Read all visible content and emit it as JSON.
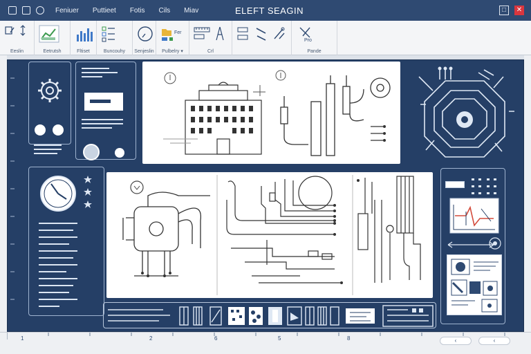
{
  "window": {
    "title": "ELEFT SEAGIN",
    "menu": [
      "Feniuer",
      "Puttieet",
      "Fotis",
      "Cils",
      "Miav"
    ],
    "maximize_glyph": "□",
    "close_glyph": "✕"
  },
  "ribbon": {
    "groups": [
      {
        "label": "Eeslin",
        "buttons": [
          "edit-grid-icon",
          "vertical-arrows-icon"
        ]
      },
      {
        "label": "Eetrutsh",
        "buttons": [
          "map-chart-icon"
        ]
      },
      {
        "label": "Fltiset",
        "buttons": [
          "bar-chart-icon"
        ]
      },
      {
        "label": "Buncouhy",
        "buttons": [
          "checklist-icon"
        ]
      },
      {
        "label": "Senjeslin",
        "buttons": [
          "gauge-icon"
        ]
      },
      {
        "label": "Pulbelry",
        "buttons": [
          "folder-icon"
        ],
        "has_dropdown": true
      },
      {
        "label": "Crl",
        "buttons": [
          "ruler-icon",
          "compass-icon"
        ]
      },
      {
        "label": "",
        "buttons": [
          "pen-icon",
          "wrench-icon",
          "link-icon"
        ]
      },
      {
        "label": "Pande",
        "buttons": [
          "tools-icon"
        ]
      }
    ],
    "inline_labels": {
      "fer": "Fer",
      "pro": "Pro"
    },
    "dropdown_glyph": "▾"
  },
  "status": {
    "start_marker": "1",
    "ticks": [
      "2",
      "6",
      "5",
      "8"
    ],
    "prev_label": "‹",
    "next_label": "‹"
  },
  "colors": {
    "workspace": "#253f66",
    "titlebar": "#2f4a72",
    "close": "#d9363e",
    "line": "#dce6f3"
  }
}
